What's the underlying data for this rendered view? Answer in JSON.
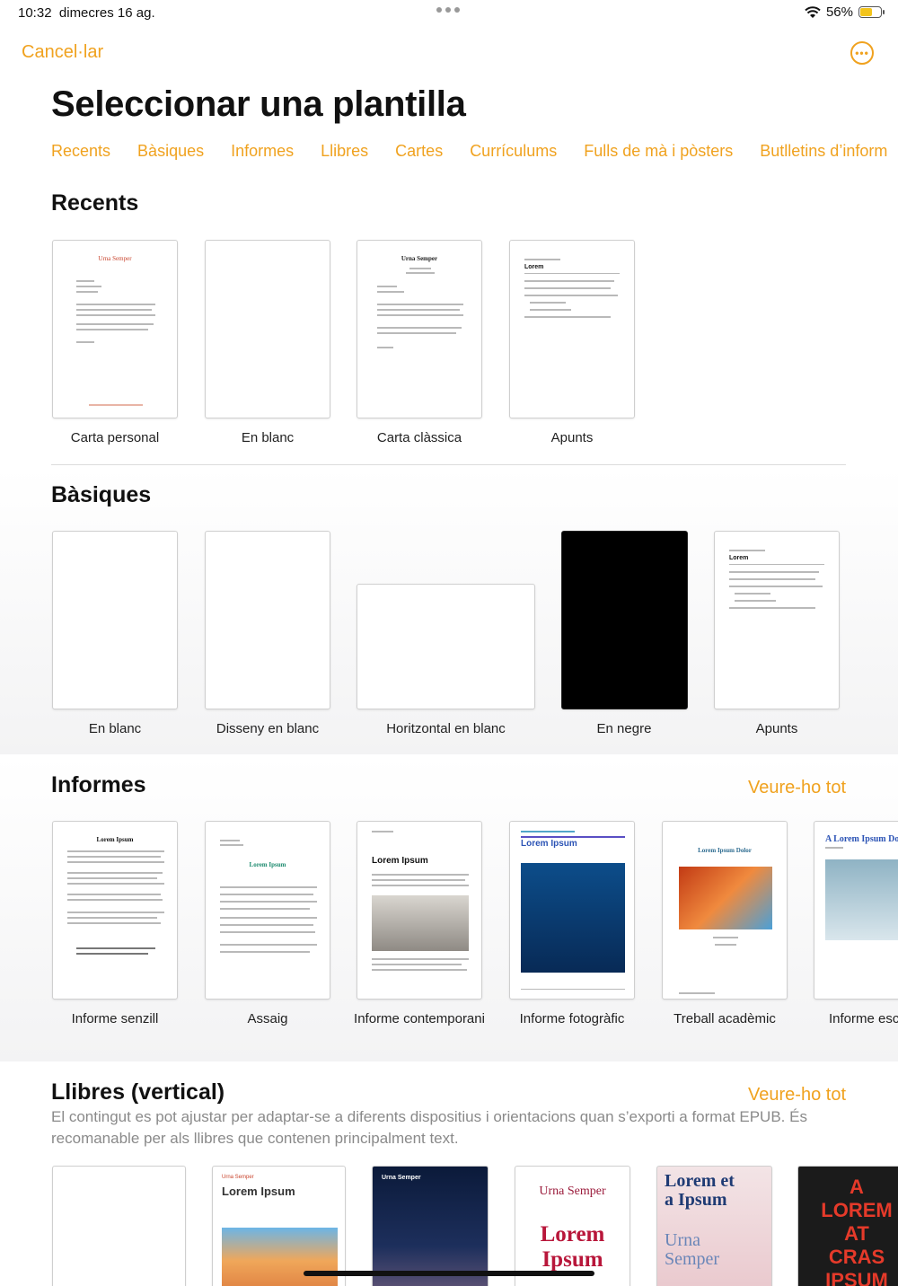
{
  "status": {
    "time": "10:32",
    "date": "dimecres 16 ag.",
    "battery": "56%"
  },
  "nav": {
    "cancel": "Cancel·lar"
  },
  "page_title": "Seleccionar una plantilla",
  "categories": [
    "Recents",
    "Bàsiques",
    "Informes",
    "Llibres",
    "Cartes",
    "Currículums",
    "Fulls de mà i pòsters",
    "Butlletins d’inform"
  ],
  "recents": {
    "title": "Recents",
    "items": [
      "Carta personal",
      "En blanc",
      "Carta clàssica",
      "Apunts"
    ],
    "thumb_text": {
      "carta_personal": "Urna Semper",
      "carta_classica": "Urna Semper",
      "apunts": "Lorem"
    }
  },
  "basiques": {
    "title": "Bàsiques",
    "items": [
      "En blanc",
      "Disseny en blanc",
      "Horitzontal en blanc",
      "En negre",
      "Apunts"
    ],
    "thumb_text": {
      "apunts": "Lorem"
    }
  },
  "informes": {
    "title": "Informes",
    "see_all": "Veure-ho tot",
    "items": [
      "Informe senzill",
      "Assaig",
      "Informe contemporani",
      "Informe fotogràfic",
      "Treball acadèmic",
      "Informe esc"
    ],
    "thumb_text": {
      "senzill": "Lorem Ipsum",
      "assaig": "Lorem Ipsum",
      "contemporani": "Lorem Ipsum",
      "fotografic": "Lorem Ipsum",
      "academic": "Lorem Ipsum Dolor",
      "esc": "A Lorem Ipsum Do"
    }
  },
  "llibres": {
    "title": "Llibres (vertical)",
    "see_all": "Veure-ho tot",
    "description": "El contingut es pot ajustar per adaptar-se a diferents dispositius i orientacions quan s’exporti a format EPUB. És recomanable per als llibres que contenen principalment text.",
    "thumb_text": {
      "b2_small": "Urna Semper",
      "b2": "Lorem Ipsum",
      "b3": "Urna Semper",
      "b4_a": "Urna Semper",
      "b4_b": "Lorem Ipsum",
      "b5_a": "Lorem et a Ipsum",
      "b5_b": "Urna Semper",
      "b6": "A LOREM AT CRAS IPSUM"
    }
  }
}
